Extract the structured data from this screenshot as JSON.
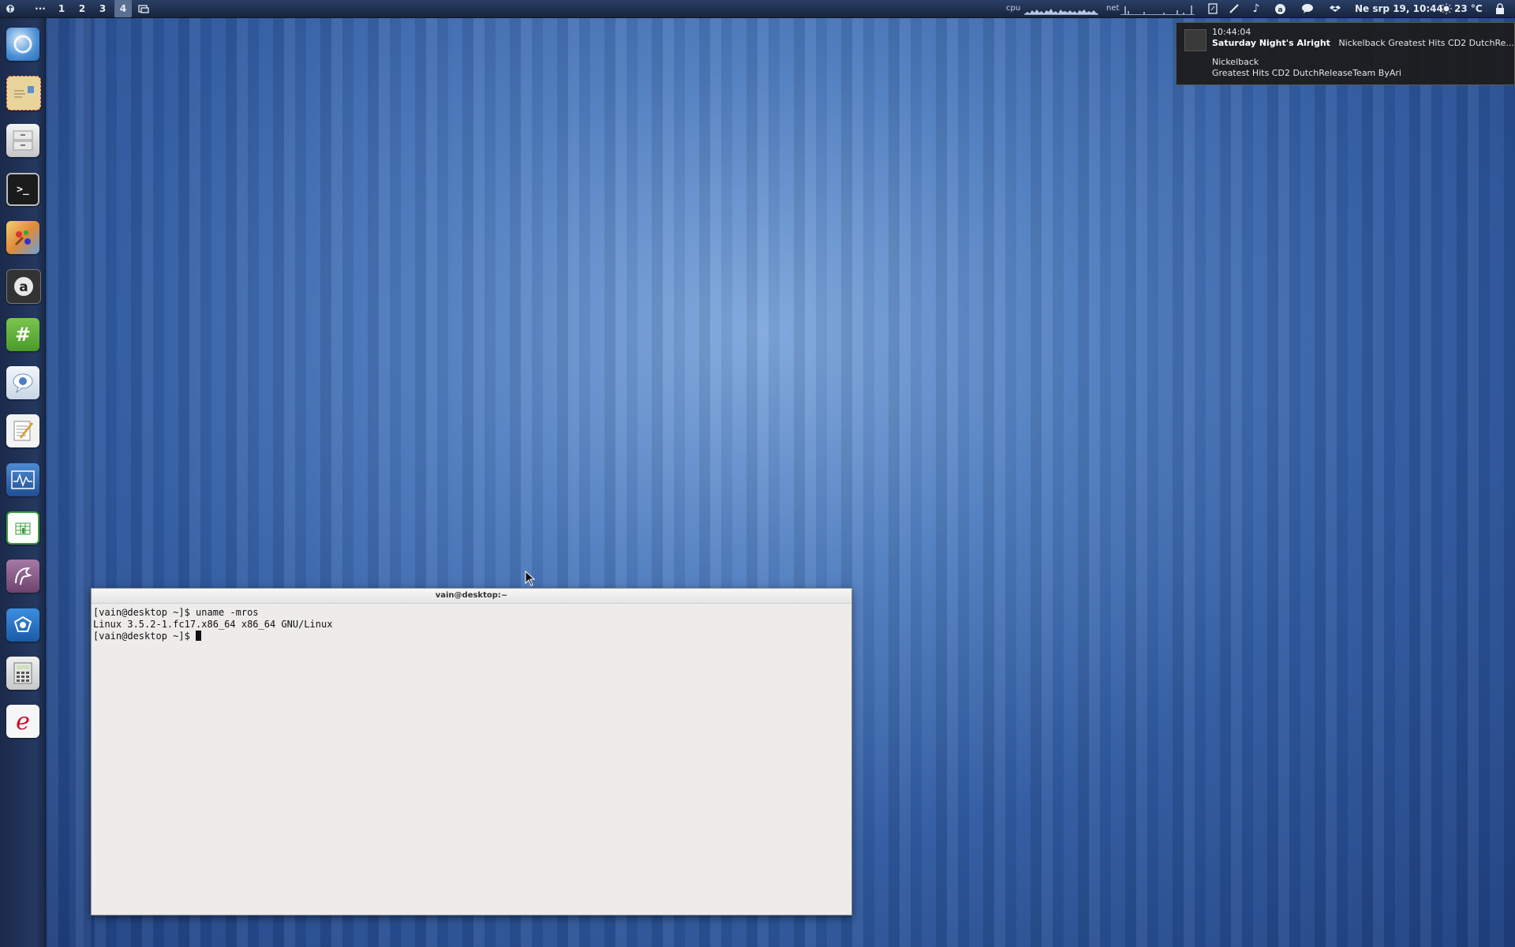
{
  "top_panel": {
    "menu_icon": "fedora-icon",
    "more_label": "···",
    "workspaces": [
      {
        "label": "1",
        "active": false
      },
      {
        "label": "2",
        "active": false
      },
      {
        "label": "3",
        "active": false
      },
      {
        "label": "4",
        "active": true
      }
    ],
    "cpu_label": "cpu",
    "net_label": "net",
    "clock": "Ne srp 19, 10:44",
    "weather": "23 °C",
    "accent": "#5b6f93"
  },
  "dock": {
    "items": [
      {
        "icon": "chromium-icon",
        "color": "#4a8fd6"
      },
      {
        "icon": "mail-icon",
        "color": "#e7cf8f"
      },
      {
        "icon": "file-manager-icon",
        "color": "#cfcfcf"
      },
      {
        "icon": "terminal-icon",
        "color": "#222"
      },
      {
        "icon": "paint-icon",
        "color": "#d9a441"
      },
      {
        "icon": "amarok-icon",
        "color": "#2b2b2b"
      },
      {
        "icon": "irc-icon",
        "color": "#5aa83a"
      },
      {
        "icon": "chat-icon",
        "color": "#e4ecf4"
      },
      {
        "icon": "text-editor-icon",
        "color": "#eeeeee"
      },
      {
        "icon": "system-monitor-icon",
        "color": "#2e63a6"
      },
      {
        "icon": "spreadsheet-icon",
        "color": "#3d9b3d"
      },
      {
        "icon": "dragon-icon",
        "color": "#8a5b8a"
      },
      {
        "icon": "shield-app-icon",
        "color": "#2f76c4"
      },
      {
        "icon": "calculator-icon",
        "color": "#d9d9d9"
      },
      {
        "icon": "evolution-icon",
        "color": "#f2f2f2"
      }
    ]
  },
  "notification": {
    "time": "10:44:04",
    "title": "Saturday Night's Alright",
    "summary_rest": "Nickelback  Greatest Hits CD2 DutchRe...",
    "artist": "Nickelback",
    "album": "Greatest Hits CD2 DutchReleaseTeam ByAri"
  },
  "terminal": {
    "title": "vain@desktop:~",
    "lines": [
      "[vain@desktop ~]$ uname -mros",
      "Linux 3.5.2-1.fc17.x86_64 x86_64 GNU/Linux",
      "[vain@desktop ~]$ "
    ]
  }
}
